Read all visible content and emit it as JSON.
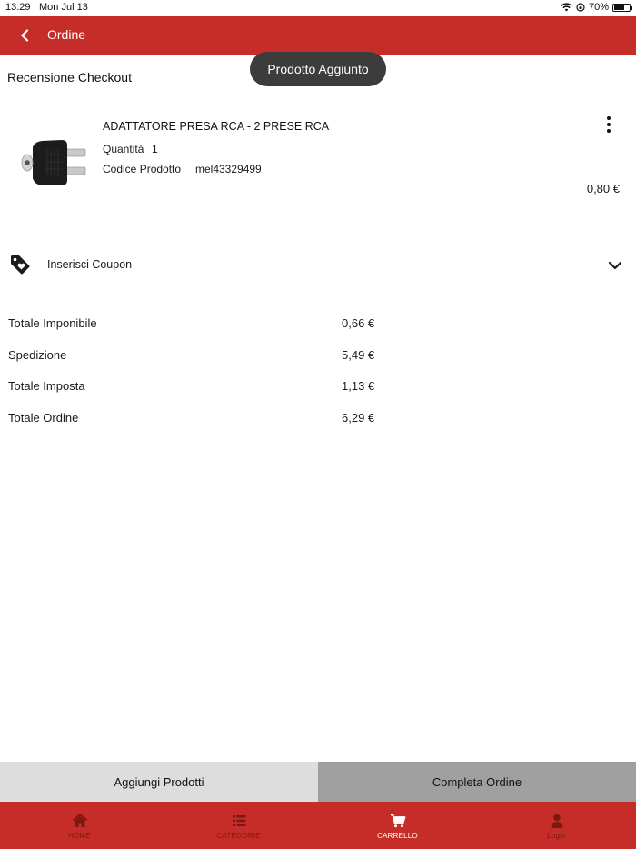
{
  "status_bar": {
    "time": "13:29",
    "date": "Mon Jul 13",
    "battery": "70%",
    "battery_level": 0.7
  },
  "header": {
    "title": "Ordine"
  },
  "toast": {
    "message": "Prodotto Aggiunto"
  },
  "section": {
    "title": "Recensione Checkout"
  },
  "product": {
    "name": "ADATTATORE PRESA RCA - 2 PRESE RCA",
    "quantity_label": "Quantità",
    "quantity": "1",
    "code_label": "Codice Prodotto",
    "code": "mel43329499",
    "price": "0,80 €"
  },
  "coupon": {
    "label": "Inserisci Coupon"
  },
  "totals": [
    {
      "label": "Totale Imponibile",
      "value": "0,66 €"
    },
    {
      "label": "Spedizione",
      "value": "5,49 €"
    },
    {
      "label": "Totale Imposta",
      "value": "1,13 €"
    },
    {
      "label": "Totale Ordine",
      "value": "6,29 €"
    }
  ],
  "actions": {
    "add_products": "Aggiungi Prodotti",
    "complete_order": "Completa Ordine"
  },
  "tabs": [
    {
      "label": "HOME",
      "icon": "home-icon"
    },
    {
      "label": "CATEGORIE",
      "icon": "list-icon"
    },
    {
      "label": "CARRELLO",
      "icon": "cart-icon"
    },
    {
      "label": "Login",
      "icon": "user-icon"
    }
  ],
  "colors": {
    "brand_red": "#c62d28",
    "toast_bg": "#3c3c3c",
    "button_light": "#dddddd",
    "button_dark": "#a0a0a0",
    "tab_inactive": "#7d1713"
  }
}
